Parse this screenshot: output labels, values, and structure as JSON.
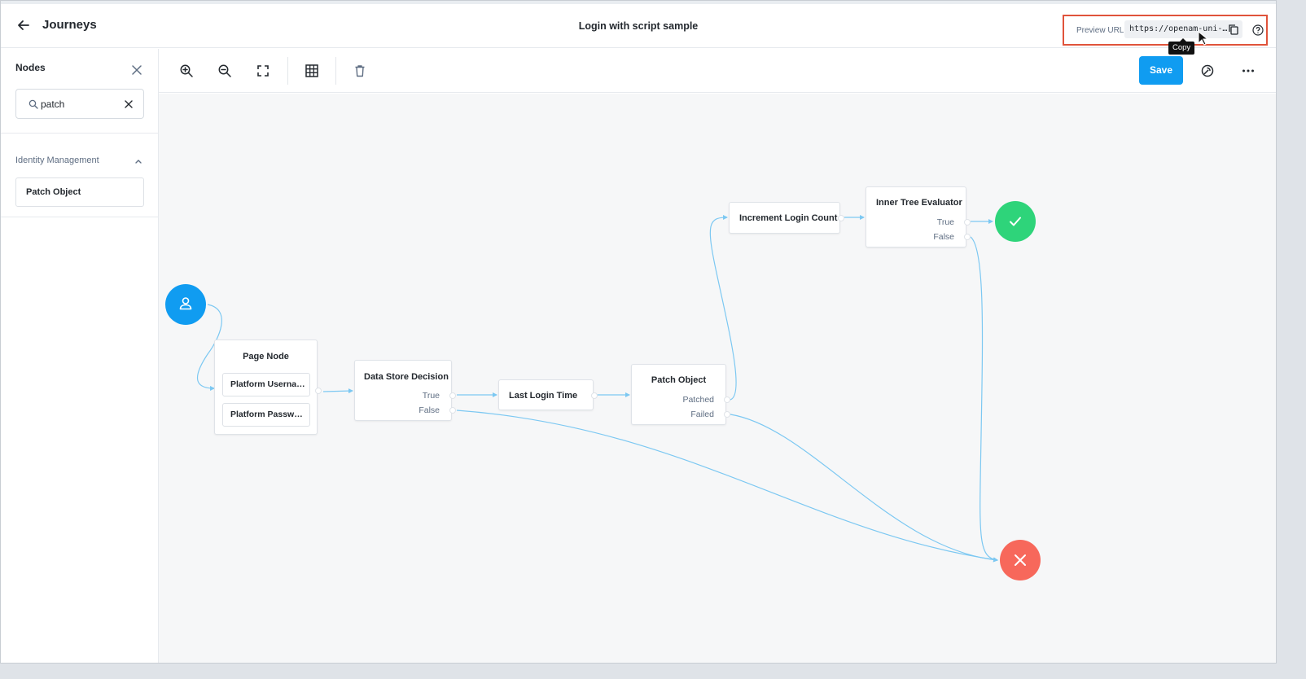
{
  "header": {
    "title": "Journeys",
    "journey_name": "Login with script sample",
    "preview_label": "Preview URL:",
    "preview_url": "https://openam-uni-…",
    "copy_tooltip": "Copy"
  },
  "sidebar": {
    "title": "Nodes",
    "search_value": "patch",
    "category": "Identity Management",
    "items": [
      {
        "label": "Patch Object"
      }
    ]
  },
  "toolbar": {
    "save_label": "Save",
    "icons": [
      "zoom-in-icon",
      "zoom-out-icon",
      "fit-screen-icon",
      "grid-icon",
      "delete-icon",
      "troubleshoot-icon",
      "more-icon"
    ]
  },
  "canvas": {
    "nodes": {
      "page_node": {
        "title": "Page Node",
        "children": [
          "Platform Userna…",
          "Platform Passw…"
        ]
      },
      "data_store": {
        "title": "Data Store Decision",
        "outcomes": [
          "True",
          "False"
        ]
      },
      "last_login": {
        "title": "Last Login Time"
      },
      "patch_object": {
        "title": "Patch Object",
        "outcomes": [
          "Patched",
          "Failed"
        ]
      },
      "increment": {
        "title": "Increment Login Count"
      },
      "inner_tree": {
        "title": "Inner Tree Evaluator",
        "outcomes": [
          "True",
          "False"
        ]
      }
    }
  },
  "colors": {
    "accent": "#109cf1",
    "start": "#109cf1",
    "success": "#2ed47a",
    "failure": "#f7685b",
    "wire": "#7cc8f2",
    "highlight": "#e0533b"
  }
}
